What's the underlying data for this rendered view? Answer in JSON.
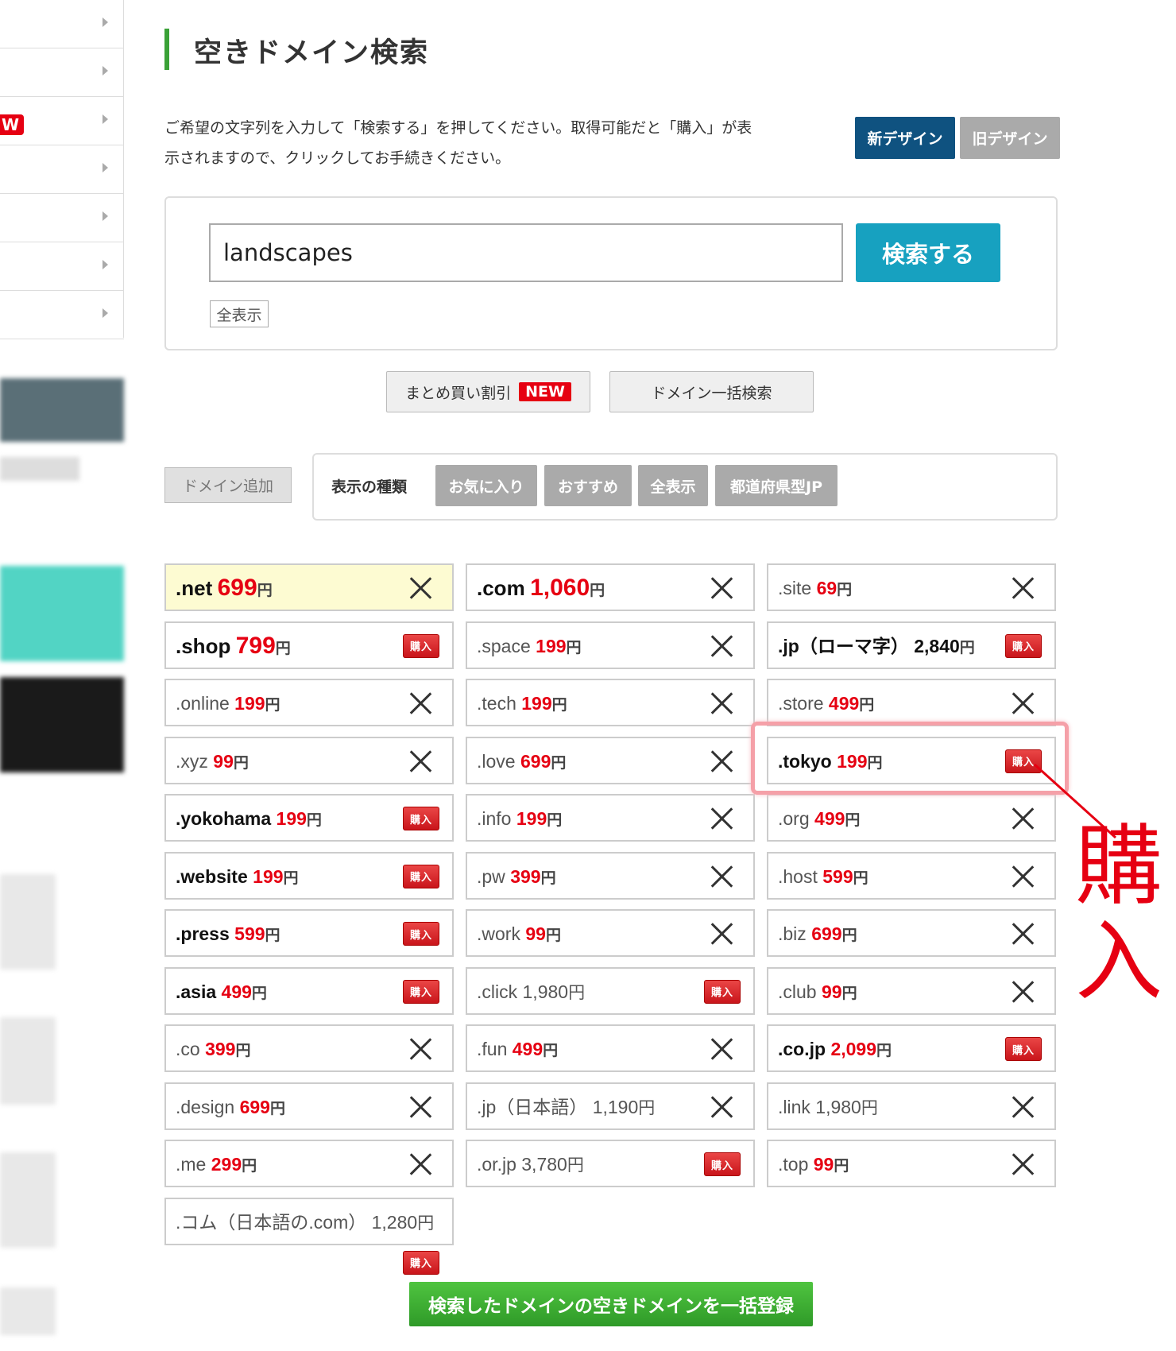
{
  "sidebar": {
    "new_badge": "W",
    "item_count": 7
  },
  "page": {
    "title": "空きドメイン検索",
    "intro_line1": "ご希望の文字列を入力して「検索する」を押してください。取得可能だと「購入」が表",
    "intro_line2": "示されますので、クリックしてお手続きください。",
    "design_new": "新デザイン",
    "design_old": "旧デザイン"
  },
  "search": {
    "value": "landscapes",
    "button": "検索する",
    "show_all": "全表示"
  },
  "tools": {
    "bulk_discount": "まとめ買い割引",
    "new_tag": "NEW",
    "bulk_search": "ドメイン一括検索"
  },
  "filter": {
    "add_domain": "ドメイン追加",
    "label": "表示の種類",
    "options": [
      "お気に入り",
      "おすすめ",
      "全表示",
      "都道府県型JP"
    ]
  },
  "buy_label": "購入",
  "yen": "円",
  "domains": [
    {
      "name": ".net",
      "price": "699",
      "available": false,
      "style": "red",
      "highlight": true,
      "big": true
    },
    {
      "name": ".com",
      "price": "1,060",
      "available": false,
      "style": "red",
      "big": true
    },
    {
      "name": ".site",
      "price": "69",
      "available": false,
      "style": "red"
    },
    {
      "name": ".shop",
      "price": "799",
      "available": true,
      "style": "red",
      "big": true
    },
    {
      "name": ".space",
      "price": "199",
      "available": false,
      "style": "red"
    },
    {
      "name": ".jp（ローマ字）",
      "price": "2,840",
      "available": true,
      "style": "blackbold"
    },
    {
      "name": ".online",
      "price": "199",
      "available": false,
      "style": "red"
    },
    {
      "name": ".tech",
      "price": "199",
      "available": false,
      "style": "red"
    },
    {
      "name": ".store",
      "price": "499",
      "available": false,
      "style": "red"
    },
    {
      "name": ".xyz",
      "price": "99",
      "available": false,
      "style": "red"
    },
    {
      "name": ".love",
      "price": "699",
      "available": false,
      "style": "red"
    },
    {
      "name": ".tokyo",
      "price": "199",
      "available": true,
      "style": "red"
    },
    {
      "name": ".yokohama",
      "price": "199",
      "available": true,
      "style": "red"
    },
    {
      "name": ".info",
      "price": "199",
      "available": false,
      "style": "red"
    },
    {
      "name": ".org",
      "price": "499",
      "available": false,
      "style": "red"
    },
    {
      "name": ".website",
      "price": "199",
      "available": true,
      "style": "red"
    },
    {
      "name": ".pw",
      "price": "399",
      "available": false,
      "style": "red"
    },
    {
      "name": ".host",
      "price": "599",
      "available": false,
      "style": "red"
    },
    {
      "name": ".press",
      "price": "599",
      "available": true,
      "style": "red"
    },
    {
      "name": ".work",
      "price": "99",
      "available": false,
      "style": "red"
    },
    {
      "name": ".biz",
      "price": "699",
      "available": false,
      "style": "red"
    },
    {
      "name": ".asia",
      "price": "499",
      "available": true,
      "style": "red"
    },
    {
      "name": ".click",
      "price": "1,980",
      "available": true,
      "style": "plain"
    },
    {
      "name": ".club",
      "price": "99",
      "available": false,
      "style": "red"
    },
    {
      "name": ".co",
      "price": "399",
      "available": false,
      "style": "red"
    },
    {
      "name": ".fun",
      "price": "499",
      "available": false,
      "style": "red"
    },
    {
      "name": ".co.jp",
      "price": "2,099",
      "available": true,
      "style": "red"
    },
    {
      "name": ".design",
      "price": "699",
      "available": false,
      "style": "red"
    },
    {
      "name": ".jp（日本語）",
      "price": "1,190",
      "available": false,
      "style": "plain"
    },
    {
      "name": ".link",
      "price": "1,980",
      "available": false,
      "style": "plain"
    },
    {
      "name": ".me",
      "price": "299",
      "available": false,
      "style": "red"
    },
    {
      "name": ".or.jp",
      "price": "3,780",
      "available": true,
      "style": "plain"
    },
    {
      "name": ".top",
      "price": "99",
      "available": false,
      "style": "red"
    },
    {
      "name": ".コム（日本語の.com）",
      "price": "1,280",
      "available": true,
      "style": "plain",
      "buy_below": true
    }
  ],
  "annotation": "購入",
  "bulk_register": "検索したドメインの空きドメインを一括登録",
  "colors": {
    "accent_green": "#3aa137",
    "search_blue": "#17a1c0",
    "price_red": "#e60012",
    "design_new": "#0f5280"
  }
}
